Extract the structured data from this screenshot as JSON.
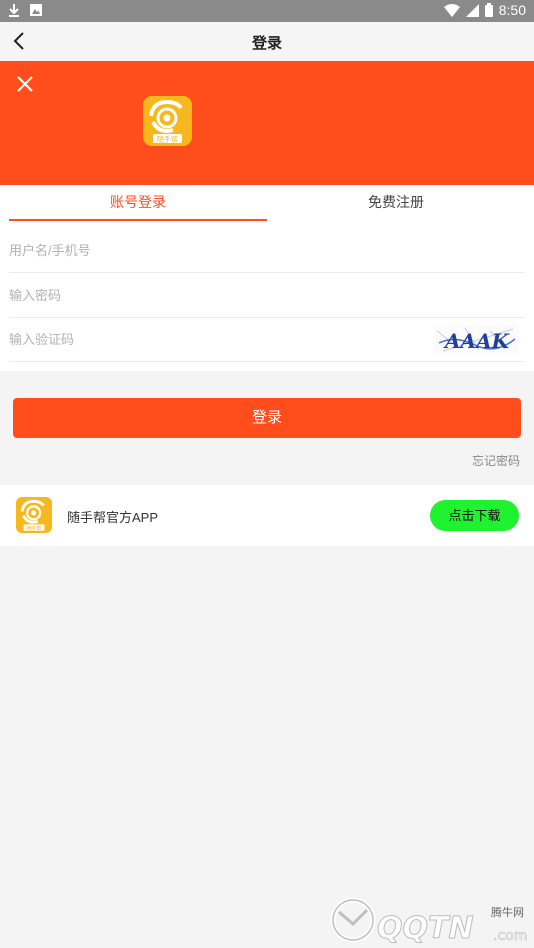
{
  "status_bar": {
    "time": "8:50",
    "icons": [
      "download-icon",
      "image-icon",
      "wifi-icon",
      "signal-icon",
      "battery-icon"
    ]
  },
  "nav": {
    "title": "登录",
    "back_icon": "chevron-left-icon"
  },
  "banner": {
    "close_icon": "close-icon",
    "logo_text": "随手帮",
    "color": "#ff4d1c"
  },
  "tabs": [
    {
      "label": "账号登录",
      "active": true
    },
    {
      "label": "免费注册",
      "active": false
    }
  ],
  "form": {
    "username_placeholder": "用户名/手机号",
    "password_placeholder": "输入密码",
    "captcha_placeholder": "输入验证码",
    "captcha_text": "AAAK"
  },
  "login_button": "登录",
  "forgot_password": "忘记密码",
  "app_card": {
    "logo_text": "随手帮",
    "label": "随手帮官方APP",
    "download_button": "点击下载"
  },
  "watermark": {
    "brand": "QQTN",
    "domain": ".com",
    "cn_text": "腾牛网"
  },
  "colors": {
    "accent": "#ff4d1c",
    "download": "#1ff22e",
    "logo": "#f7b81e"
  }
}
